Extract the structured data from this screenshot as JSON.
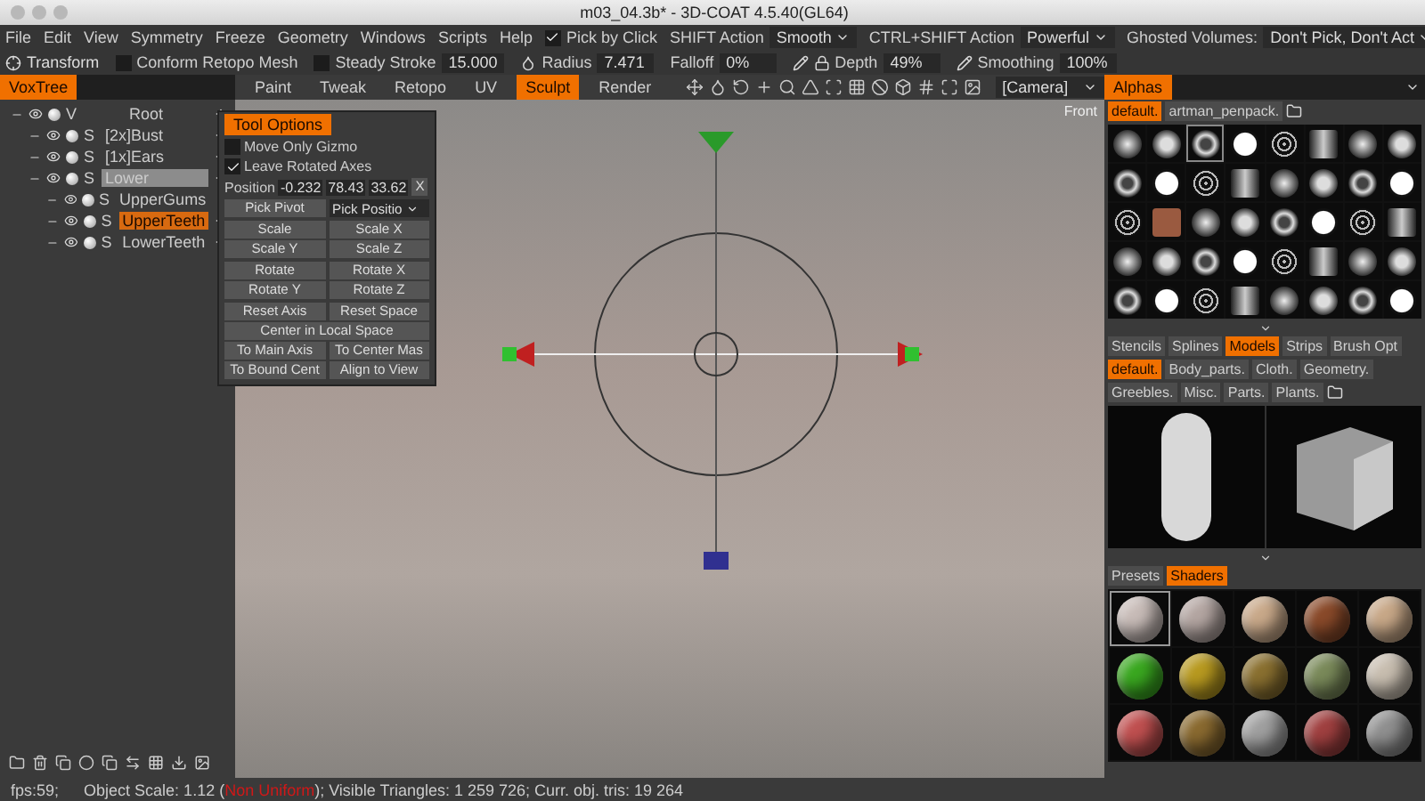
{
  "window": {
    "title": "m03_04.3b* - 3D-COAT 4.5.40(GL64)"
  },
  "menu": [
    "File",
    "Edit",
    "View",
    "Symmetry",
    "Freeze",
    "Geometry",
    "Windows",
    "Scripts",
    "Help"
  ],
  "menu_options": [
    {
      "kind": "check",
      "label": "Pick by Click",
      "checked": true
    },
    {
      "kind": "select",
      "label": "SHIFT Action",
      "value": "Smooth"
    },
    {
      "kind": "select",
      "label": "CTRL+SHIFT Action",
      "value": "Powerful"
    },
    {
      "kind": "select",
      "label": "Ghosted Volumes:",
      "value": "Don't Pick, Don't Act"
    }
  ],
  "toolbar": [
    {
      "kind": "button",
      "label": "Transform"
    },
    {
      "kind": "check",
      "label": "Conform Retopo Mesh",
      "checked": false
    },
    {
      "kind": "field",
      "label": "Steady Stroke",
      "value": "15.000",
      "checked": false
    },
    {
      "kind": "field",
      "label": "Radius",
      "value": "7.471"
    },
    {
      "kind": "field",
      "label": "Falloff",
      "value": "0%"
    },
    {
      "kind": "field",
      "label": "Depth",
      "value": "49%"
    },
    {
      "kind": "field",
      "label": "Smoothing",
      "value": "100%"
    }
  ],
  "left_tab": {
    "label": "VoxTree",
    "selected": true
  },
  "rooms": [
    {
      "label": "Paint",
      "selected": false
    },
    {
      "label": "Tweak",
      "selected": false
    },
    {
      "label": "Retopo",
      "selected": false
    },
    {
      "label": "UV",
      "selected": false
    },
    {
      "label": "Sculpt",
      "selected": true
    },
    {
      "label": "Render",
      "selected": false
    }
  ],
  "camera": {
    "value": "[Camera]"
  },
  "tree": [
    {
      "type": "V",
      "name": "Root",
      "selected": false,
      "children": [
        {
          "type": "S",
          "name": "[2x]Bust",
          "selected": false
        },
        {
          "type": "S",
          "name": "[1x]Ears",
          "selected": false
        },
        {
          "type": "S",
          "name": "Lower",
          "selected": false,
          "editing": true,
          "children": [
            {
              "type": "S",
              "name": "UpperGums",
              "selected": false
            },
            {
              "type": "S",
              "name": "UpperTeeth",
              "selected": true
            },
            {
              "type": "S",
              "name": "LowerTeeth",
              "selected": false
            }
          ]
        }
      ]
    }
  ],
  "tool_options": {
    "title": "Tool Options",
    "checks": [
      {
        "label": "Move Only Gizmo",
        "checked": false
      },
      {
        "label": "Leave Rotated Axes",
        "checked": true
      }
    ],
    "position": {
      "label": "Position",
      "values": [
        "-0.232",
        "78.43",
        "33.62"
      ],
      "clear": "X"
    },
    "pivot": {
      "button": "Pick Pivot",
      "select": "Pick Positio"
    },
    "button_groups": [
      [
        "Scale",
        "Scale X",
        "Scale Y",
        "Scale Z"
      ],
      [
        "Rotate",
        "Rotate X",
        "Rotate Y",
        "Rotate Z"
      ],
      [
        "Reset Axis",
        "Reset Space",
        "Center in Local Space",
        "To Main Axis",
        "To Center Mas",
        "To Bound Cent",
        "Align to View"
      ]
    ]
  },
  "view_label": "Front",
  "alphas": {
    "tab": "Alphas",
    "sets": [
      {
        "label": "default.",
        "selected": true
      },
      {
        "label": "artman_penpack.",
        "selected": false
      }
    ],
    "items": [
      {
        "selected": false
      },
      {
        "selected": false
      },
      {
        "selected": true
      },
      {
        "selected": false
      },
      {
        "selected": false
      },
      {
        "selected": false
      },
      {
        "selected": false
      },
      {
        "selected": false
      },
      {
        "selected": false
      },
      {
        "selected": false
      },
      {
        "selected": false
      },
      {
        "selected": false
      },
      {
        "selected": false
      },
      {
        "selected": false
      },
      {
        "selected": false
      },
      {
        "selected": false
      },
      {
        "selected": false
      },
      {
        "selected": false
      },
      {
        "selected": false
      },
      {
        "selected": false
      },
      {
        "selected": false
      },
      {
        "selected": false
      },
      {
        "selected": false
      },
      {
        "selected": false
      },
      {
        "selected": false
      },
      {
        "selected": false
      },
      {
        "selected": false
      },
      {
        "selected": false
      },
      {
        "selected": false
      },
      {
        "selected": false
      },
      {
        "selected": false
      },
      {
        "selected": false
      },
      {
        "selected": false
      },
      {
        "selected": false
      },
      {
        "selected": false
      },
      {
        "selected": false
      },
      {
        "selected": false
      },
      {
        "selected": false
      },
      {
        "selected": false
      },
      {
        "selected": false
      }
    ]
  },
  "models": {
    "tabs": [
      {
        "label": "Stencils",
        "selected": false
      },
      {
        "label": "Splines",
        "selected": false
      },
      {
        "label": "Models",
        "selected": true
      },
      {
        "label": "Strips",
        "selected": false
      },
      {
        "label": "Brush Opt",
        "selected": false
      }
    ],
    "sets": [
      {
        "label": "default.",
        "selected": true
      },
      {
        "label": "Body_parts.",
        "selected": false
      },
      {
        "label": "Cloth.",
        "selected": false
      },
      {
        "label": "Geometry.",
        "selected": false
      },
      {
        "label": "Greebles.",
        "selected": false
      },
      {
        "label": "Misc.",
        "selected": false
      },
      {
        "label": "Parts.",
        "selected": false
      },
      {
        "label": "Plants.",
        "selected": false
      }
    ],
    "items": [
      {
        "kind": "capsule"
      },
      {
        "kind": "cube"
      }
    ]
  },
  "shaders": {
    "tabs": [
      {
        "label": "Presets",
        "selected": false
      },
      {
        "label": "Shaders",
        "selected": true
      }
    ],
    "items": [
      {
        "color": "#c8bcb8",
        "selected": true
      },
      {
        "color": "#b4a6a2",
        "selected": false
      },
      {
        "color": "#c9a98a",
        "selected": false
      },
      {
        "color": "#8a4a2a",
        "selected": false
      },
      {
        "color": "#c8a888",
        "selected": false
      },
      {
        "color": "#3aa820",
        "selected": false
      },
      {
        "color": "#b89a20",
        "selected": false
      },
      {
        "color": "#8a7030",
        "selected": false
      },
      {
        "color": "#7a8a5a",
        "selected": false
      },
      {
        "color": "#c8beb0",
        "selected": false
      },
      {
        "color": "#c05050",
        "selected": false
      },
      {
        "color": "#8a6a30",
        "selected": false
      },
      {
        "color": "#a0a0a0",
        "selected": false
      },
      {
        "color": "#a04040",
        "selected": false
      },
      {
        "color": "#909090",
        "selected": false
      }
    ]
  },
  "status": [
    {
      "text": "fps:59;"
    },
    {
      "text": "Object Scale: 1.12 (",
      "kind": "normal"
    },
    {
      "text": "Non Uniform",
      "kind": "warning"
    },
    {
      "text": "); Visible Triangles: 1 259 726; Curr. obj. tris: 19 264",
      "kind": "normal"
    }
  ]
}
